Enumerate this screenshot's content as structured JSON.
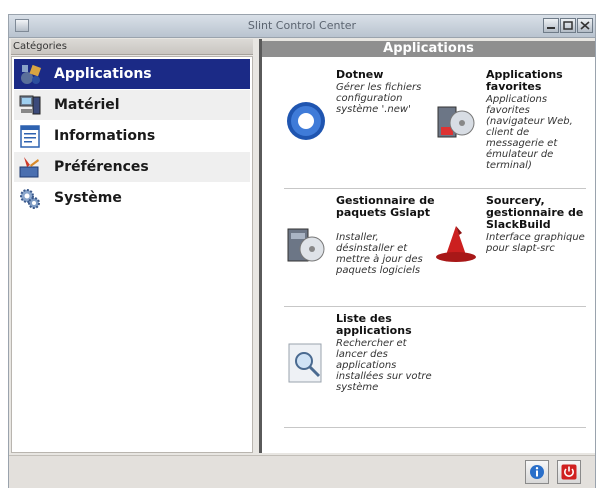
{
  "window": {
    "title": "Slint Control Center"
  },
  "sidebar": {
    "header": "Catégories",
    "items": [
      {
        "label": "Applications",
        "icon": "applications-icon"
      },
      {
        "label": "Matériel",
        "icon": "hardware-icon"
      },
      {
        "label": "Informations",
        "icon": "information-icon"
      },
      {
        "label": "Préférences",
        "icon": "preferences-icon"
      },
      {
        "label": "Système",
        "icon": "system-gear-icon"
      }
    ],
    "selected": "Applications"
  },
  "main": {
    "header": "Applications",
    "apps": [
      {
        "name": "Dotnew",
        "desc": "Gérer les fichiers configuration système '.new'",
        "icon": "dotnew-icon"
      },
      {
        "name": "Applications favorites",
        "desc": "Applications favorites (navigateur Web, client de messagerie et émulateur de terminal)",
        "icon": "favorite-apps-icon"
      },
      {
        "name": "Gestionnaire de paquets Gslapt",
        "desc": "Installer, désinstaller et mettre à jour des paquets logiciels",
        "icon": "package-manager-icon"
      },
      {
        "name": "Sourcery, gestionnaire de SlackBuild",
        "desc": "Interface graphique pour slapt-src",
        "icon": "wizard-hat-icon"
      },
      {
        "name": "Liste des applications",
        "desc": "Rechercher et lancer des applications installées sur votre système",
        "icon": "application-list-icon"
      }
    ]
  },
  "footer": {
    "buttons": [
      "info-icon",
      "power-icon"
    ]
  },
  "colors": {
    "selection": "#1b2a86",
    "header": "#8f8f8f",
    "power": "#d02020",
    "info": "#2a6fc9"
  }
}
